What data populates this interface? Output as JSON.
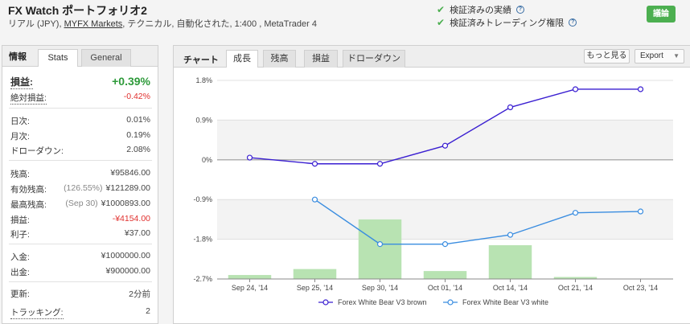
{
  "header": {
    "title": "FX Watch ポートフォリオ2",
    "subtitle_pre": "リアル (JPY), ",
    "broker": "MYFX Markets",
    "subtitle_post": ", テクニカル, 自動化された, 1:400 , MetaTrader 4",
    "verified_track": "検証済みの実績",
    "verified_privileges": "検証済みトレーディング権限",
    "discuss_button": "議論"
  },
  "left_tabs": {
    "info": "情報",
    "stats": "Stats",
    "general": "General"
  },
  "stats": {
    "gain_label": "損益:",
    "gain_value": "+0.39%",
    "abs_gain_label": "絶対損益:",
    "abs_gain_value": "-0.42%",
    "daily_label": "日次:",
    "daily_value": "0.01%",
    "monthly_label": "月次:",
    "monthly_value": "0.19%",
    "drawdown_label": "ドローダウン:",
    "drawdown_value": "2.08%",
    "balance_label": "残高:",
    "balance_value": "¥95846.00",
    "equity_label": "有効残高:",
    "equity_pct": "(126.55%)",
    "equity_value": "¥121289.00",
    "highest_label": "最高残高:",
    "highest_date": "(Sep 30)",
    "highest_value": "¥1000893.00",
    "profit_label": "損益:",
    "profit_value": "-¥4154.00",
    "interest_label": "利子:",
    "interest_value": "¥37.00",
    "deposits_label": "入金:",
    "deposits_value": "¥1000000.00",
    "withdrawals_label": "出金:",
    "withdrawals_value": "¥900000.00",
    "updated_label": "更新:",
    "updated_value": "2分前",
    "tracking_label": "トラッキング:",
    "tracking_value": "2"
  },
  "chart_tabs": {
    "label": "チャート",
    "growth": "成長",
    "balance": "残高",
    "profit": "損益",
    "drawdown": "ドローダウン",
    "more_button": "もっと見る",
    "export_button": "Export"
  },
  "chart_data": {
    "type": "line",
    "categories": [
      "Sep 24, '14",
      "Sep 25, '14",
      "Sep 30, '14",
      "Oct 01, '14",
      "Oct 14, '14",
      "Oct 21, '14",
      "Oct 23, '14"
    ],
    "ylim": [
      -2.7,
      1.8
    ],
    "y_ticks": [
      "1.8%",
      "0.9%",
      "0%",
      "-0.9%",
      "-1.8%",
      "-2.7%"
    ],
    "series": [
      {
        "name": "Forex White Bear V3  brown",
        "color": "#3a1fd1",
        "values": [
          0.05,
          -0.09,
          -0.09,
          0.32,
          1.19,
          1.6,
          1.6
        ]
      },
      {
        "name": "Forex White Bear V3  white",
        "color": "#3a8de0",
        "values": [
          null,
          -0.9,
          -1.91,
          -1.91,
          -1.7,
          -1.2,
          -1.17
        ]
      }
    ],
    "bars": {
      "color": "#b8e3b2",
      "values": [
        0.02,
        0.05,
        0.3,
        0.04,
        0.17,
        0.01,
        0.0
      ]
    }
  }
}
